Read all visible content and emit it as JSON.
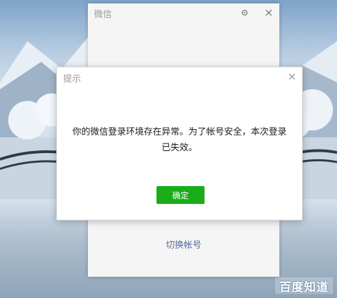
{
  "wechat_window": {
    "title": "微信",
    "switch_account_label": "切换帐号",
    "settings_icon": "gear-icon",
    "close_icon": "close-icon"
  },
  "dialog": {
    "title": "提示",
    "message": "你的微信登录环境存在异常。为了帐号安全，本次登录已失效。",
    "confirm_label": "确定",
    "close_icon": "close-icon"
  },
  "watermark": {
    "text": "百度知道"
  },
  "colors": {
    "accent_green": "#1aad19",
    "link_blue": "#576b95",
    "title_gray": "#9a9a9a"
  }
}
